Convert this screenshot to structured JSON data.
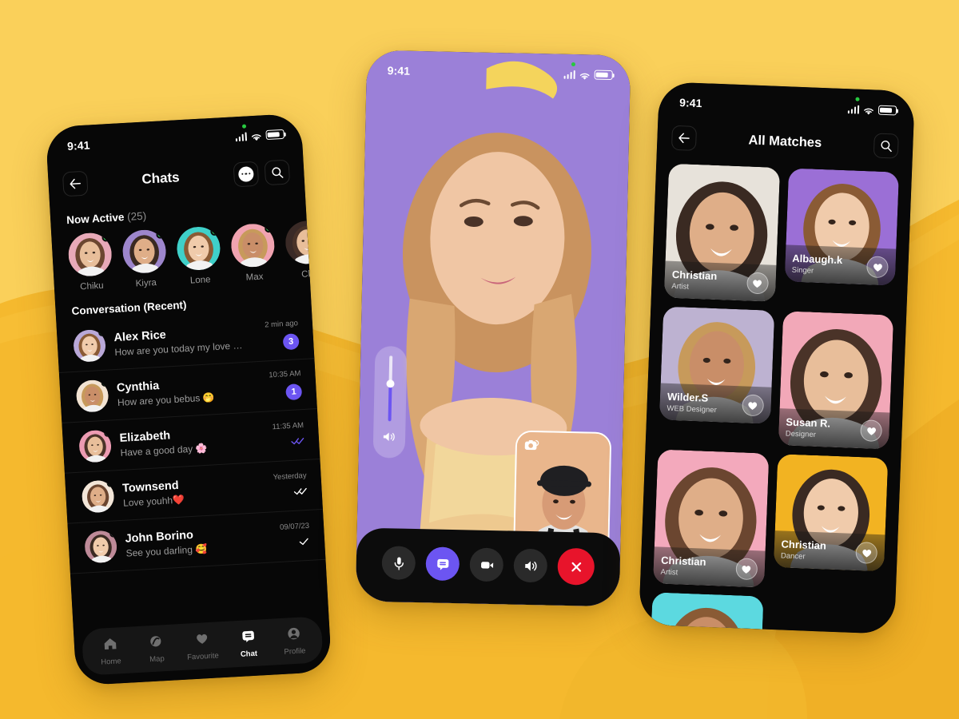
{
  "theme": {
    "bg_yellow_light": "#FAD05A",
    "bg_yellow_mid": "#F5B92E",
    "bg_yellow_deep": "#EFAE24",
    "accent_purple": "#6C55F2",
    "danger_red": "#E8142B",
    "online_green": "#2ECC5A",
    "phone_black": "#080808"
  },
  "phone_chats": {
    "status": {
      "time": "9:41",
      "signal_icon": "cellular-bars-icon",
      "wifi_icon": "wifi-icon",
      "battery_icon": "battery-icon"
    },
    "header": {
      "back_icon": "arrow-left-icon",
      "title": "Chats",
      "more_icon": "more-dots-icon",
      "search_icon": "search-icon"
    },
    "now_active": {
      "label": "Now Active",
      "count": "(25)",
      "users": [
        {
          "name": "Chiku",
          "bg": "#E8A9B8",
          "online": true
        },
        {
          "name": "Kiyra",
          "bg": "#9D86CC",
          "online": true
        },
        {
          "name": "Lone",
          "bg": "#3FD0C9",
          "online": true
        },
        {
          "name": "Max",
          "bg": "#F0A3B0",
          "online": true
        },
        {
          "name": "Chr",
          "bg": "#3A2A26",
          "online": true
        }
      ]
    },
    "conversation": {
      "label": "Conversation (Recent)",
      "items": [
        {
          "name": "Alex Rice",
          "message": "How are you today my love ❤️❤️",
          "time": "2 min ago",
          "badge": "3",
          "receipt": "",
          "online": true,
          "bg": "#B9A8D8"
        },
        {
          "name": "Cynthia",
          "message": "How are you bebus 🤭",
          "time": "10:35 AM",
          "badge": "1",
          "receipt": "",
          "online": true,
          "bg": "#F2E3D2"
        },
        {
          "name": "Elizabeth",
          "message": "Have a good day 🌸",
          "time": "11:35 AM",
          "badge": "",
          "receipt": "double-check-blue",
          "online": false,
          "bg": "#EC9BB2"
        },
        {
          "name": "Townsend",
          "message": "Love youhh❤️",
          "time": "Yesterday",
          "badge": "",
          "receipt": "double-check-white",
          "online": true,
          "bg": "#F3E6D8"
        },
        {
          "name": "John Borino",
          "message": "See you darling 🥰",
          "time": "09/07/23",
          "badge": "",
          "receipt": "single-check-white",
          "online": false,
          "bg": "#BE8A98"
        }
      ]
    },
    "tabbar": [
      {
        "label": "Home",
        "icon": "home-icon",
        "active": false
      },
      {
        "label": "Map",
        "icon": "map-icon",
        "active": false
      },
      {
        "label": "Favourite",
        "icon": "heart-icon",
        "active": false
      },
      {
        "label": "Chat",
        "icon": "chat-icon",
        "active": true
      },
      {
        "label": "Profile",
        "icon": "profile-icon",
        "active": false
      }
    ]
  },
  "phone_call": {
    "status": {
      "time": "9:41",
      "signal_icon": "cellular-bars-icon",
      "wifi_icon": "wifi-icon",
      "battery_icon": "battery-icon"
    },
    "background_color": "#9B80D8",
    "volume_slider": {
      "icon": "speaker-icon",
      "level_percent": 56
    },
    "pip": {
      "flip_icon": "camera-flip-icon",
      "bg": "#E9B68C"
    },
    "controls": [
      {
        "name": "mute-button",
        "icon": "microphone-icon",
        "state": "off"
      },
      {
        "name": "chat-button",
        "icon": "chat-icon",
        "state": "active"
      },
      {
        "name": "video-button",
        "icon": "video-camera-icon",
        "state": "off"
      },
      {
        "name": "speaker-button",
        "icon": "speaker-icon",
        "state": "off"
      },
      {
        "name": "end-call-button",
        "icon": "close-x-icon",
        "state": "end"
      }
    ]
  },
  "phone_matches": {
    "status": {
      "time": "9:41",
      "signal_icon": "cellular-bars-icon",
      "wifi_icon": "wifi-icon",
      "battery_icon": "battery-icon"
    },
    "header": {
      "back_icon": "arrow-left-icon",
      "title": "All Matches",
      "search_icon": "search-icon"
    },
    "cards": [
      {
        "name": "Christian",
        "role": "Artist",
        "bg": "#E7E2DA",
        "tall": true,
        "liked": false
      },
      {
        "name": "Albaugh.k",
        "role": "Singer",
        "bg": "#9B6FD6",
        "tall": false,
        "liked": false
      },
      {
        "name": "Wilder.S",
        "role": "WEB Designer",
        "bg": "#BDB2D1",
        "tall": false,
        "liked": false
      },
      {
        "name": "Susan R.",
        "role": "Designer",
        "bg": "#F2A8B8",
        "tall": true,
        "liked": false
      },
      {
        "name": "Christian",
        "role": "Artist",
        "bg": "#F3A9BC",
        "tall": true,
        "liked": false
      },
      {
        "name": "Christian",
        "role": "Dancer",
        "bg": "#F2B322",
        "tall": false,
        "liked": false
      },
      {
        "name": "",
        "role": "",
        "bg": "#5CD9E0",
        "tall": false,
        "liked": false
      }
    ]
  }
}
